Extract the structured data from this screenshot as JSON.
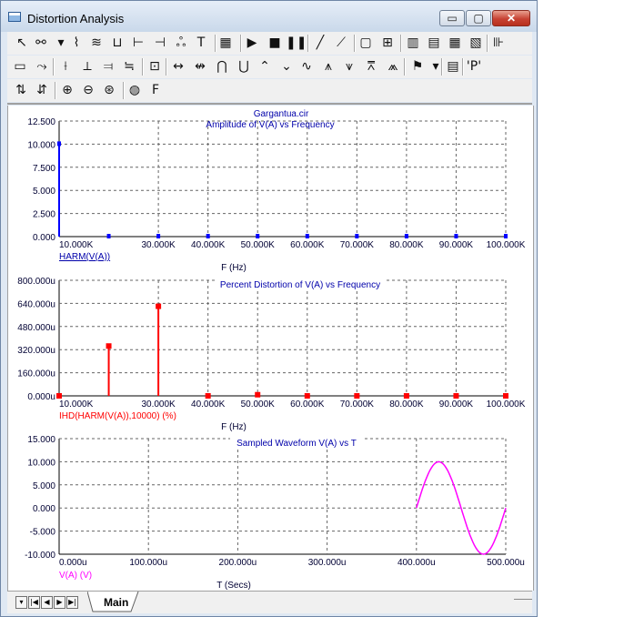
{
  "window": {
    "title": "Distortion Analysis",
    "controls": {
      "minimize": "▭",
      "maximize": "▢",
      "close": "✕"
    }
  },
  "toolbar_row1": [
    {
      "name": "select-arrow-icon",
      "glyph": "↖"
    },
    {
      "name": "component-icon",
      "glyph": "⚯"
    },
    {
      "name": "dropdown-arrow-icon",
      "glyph": "▾"
    },
    {
      "name": "wire-icon",
      "glyph": "⌇"
    },
    {
      "name": "diagonal-wire-icon",
      "glyph": "≋"
    },
    {
      "name": "bus-icon",
      "glyph": "⊔"
    },
    {
      "name": "connector-icon",
      "glyph": "⊢"
    },
    {
      "name": "node-icon",
      "glyph": "⊣"
    },
    {
      "name": "junction-icon",
      "glyph": "ஃ"
    },
    {
      "name": "text-icon",
      "glyph": "T"
    },
    {
      "name": "properties-icon",
      "glyph": "▦"
    },
    {
      "name": "run-icon",
      "glyph": "▶"
    },
    {
      "name": "stop-icon",
      "glyph": "■"
    },
    {
      "name": "pause-icon",
      "glyph": "❚❚"
    },
    {
      "name": "line-icon",
      "glyph": "╱"
    },
    {
      "name": "diagonal-line-icon",
      "glyph": "⟋"
    },
    {
      "name": "box-icon",
      "glyph": "▢"
    },
    {
      "name": "grid-icon",
      "glyph": "⊞"
    },
    {
      "name": "vertical-grid-icon",
      "glyph": "▥"
    },
    {
      "name": "horizontal-grid-icon",
      "glyph": "▤"
    },
    {
      "name": "minor-grid-icon",
      "glyph": "▦"
    },
    {
      "name": "scale-grid-icon",
      "glyph": "▧"
    },
    {
      "name": "axis-icon",
      "glyph": "⊪"
    }
  ],
  "toolbar_row2": [
    {
      "name": "frame-icon",
      "glyph": "▭"
    },
    {
      "name": "trace-icon",
      "glyph": "⤳"
    },
    {
      "name": "tag-icon",
      "glyph": "⟊"
    },
    {
      "name": "point-tag-icon",
      "glyph": "⟂"
    },
    {
      "name": "horizontal-tag-icon",
      "glyph": "⫤"
    },
    {
      "name": "vertical-tag-icon",
      "glyph": "≒"
    },
    {
      "name": "graph-icon",
      "glyph": "⊡"
    },
    {
      "name": "next-point-icon",
      "glyph": "↔"
    },
    {
      "name": "prev-point-icon",
      "glyph": "↮"
    },
    {
      "name": "peak-icon",
      "glyph": "⋂"
    },
    {
      "name": "valley-icon",
      "glyph": "⋃"
    },
    {
      "name": "high-icon",
      "glyph": "⌃"
    },
    {
      "name": "low-icon",
      "glyph": "⌄"
    },
    {
      "name": "inflection-icon",
      "glyph": "∿"
    },
    {
      "name": "global-high-icon",
      "glyph": "⩚"
    },
    {
      "name": "global-low-icon",
      "glyph": "⩛"
    },
    {
      "name": "top-icon",
      "glyph": "⩞"
    },
    {
      "name": "bottom-icon",
      "glyph": "⩕"
    },
    {
      "name": "data-points-icon",
      "glyph": "⚑"
    },
    {
      "name": "tokens-dropdown-icon",
      "glyph": "▾"
    },
    {
      "name": "table-icon",
      "glyph": "▤"
    },
    {
      "name": "p-key-icon",
      "glyph": "'P'"
    }
  ],
  "toolbar_row3": [
    {
      "name": "x-cursor-icon",
      "glyph": "⇅"
    },
    {
      "name": "y-cursor-icon",
      "glyph": "⇵"
    },
    {
      "name": "zoom-in-icon",
      "glyph": "⊕"
    },
    {
      "name": "zoom-out-icon",
      "glyph": "⊖"
    },
    {
      "name": "zoom-fit-icon",
      "glyph": "⊛"
    },
    {
      "name": "mouse-icon",
      "glyph": "◍"
    },
    {
      "name": "font-icon",
      "glyph": "F"
    }
  ],
  "tabs": {
    "active": "Main"
  },
  "plots": {
    "file": "Gargantua.cir",
    "amplitude": {
      "title": "Amplitude of V(A) vs Frequency",
      "legend": "HARM(V(A))",
      "xlabel": "F (Hz)",
      "yticks": [
        "12.500",
        "10.000",
        "7.500",
        "5.000",
        "2.500",
        "0.000"
      ],
      "xticks": [
        "10.000K",
        "30.000K",
        "40.000K",
        "50.000K",
        "60.000K",
        "70.000K",
        "80.000K",
        "90.000K",
        "100.000K"
      ],
      "color": "#0000ff"
    },
    "distortion": {
      "title": "Percent Distortion of V(A) vs Frequency",
      "legend": "IHD(HARM(V(A)),10000) (%)",
      "xlabel": "F (Hz)",
      "yticks": [
        "800.000u",
        "640.000u",
        "480.000u",
        "320.000u",
        "160.000u",
        "0.000u"
      ],
      "xticks": [
        "10.000K",
        "30.000K",
        "40.000K",
        "50.000K",
        "60.000K",
        "70.000K",
        "80.000K",
        "90.000K",
        "100.000K"
      ],
      "color": "#ff0000"
    },
    "waveform": {
      "title": "Sampled Waveform  V(A) vs T",
      "legend": "V(A) (V)",
      "xlabel": "T (Secs)",
      "yticks": [
        "15.000",
        "10.000",
        "5.000",
        "0.000",
        "-5.000",
        "-10.000"
      ],
      "xticks": [
        "0.000u",
        "100.000u",
        "200.000u",
        "300.000u",
        "400.000u",
        "500.000u"
      ],
      "color": "#ff00ff"
    }
  },
  "chart_data": [
    {
      "type": "bar",
      "title": "Amplitude of V(A) vs Frequency",
      "xlabel": "F (Hz)",
      "ylabel": "",
      "xlim": [
        10000,
        100000
      ],
      "ylim": [
        0,
        12.5
      ],
      "series": [
        {
          "name": "HARM(V(A))",
          "x": [
            10000,
            20000,
            30000,
            40000,
            50000,
            60000,
            70000,
            80000,
            90000,
            100000
          ],
          "values": [
            10,
            0,
            0,
            0,
            0,
            0,
            0,
            0,
            0,
            0
          ]
        }
      ]
    },
    {
      "type": "bar",
      "title": "Percent Distortion of V(A) vs Frequency",
      "xlabel": "F (Hz)",
      "ylabel": "",
      "xlim": [
        10000,
        100000
      ],
      "ylim": [
        0,
        0.0008
      ],
      "series": [
        {
          "name": "IHD(HARM(V(A)),10000) (%)",
          "x": [
            10000,
            20000,
            30000,
            40000,
            50000,
            60000,
            70000,
            80000,
            90000,
            100000
          ],
          "values": [
            0,
            0.000345,
            0.00062,
            0,
            8e-06,
            0,
            0,
            0,
            0,
            0
          ]
        }
      ]
    },
    {
      "type": "line",
      "title": "Sampled Waveform  V(A) vs T",
      "xlabel": "T (Secs)",
      "ylabel": "",
      "xlim": [
        0,
        0.0005
      ],
      "ylim": [
        -10,
        15
      ],
      "series": [
        {
          "name": "V(A) (V)",
          "x": [
            0.0004,
            0.0004125,
            0.000425,
            0.0004375,
            0.00045,
            0.0004625,
            0.000475,
            0.0004875,
            0.0005
          ],
          "values": [
            0,
            7.07,
            10,
            7.07,
            0,
            -7.07,
            -10,
            -7.07,
            0
          ]
        }
      ]
    }
  ]
}
